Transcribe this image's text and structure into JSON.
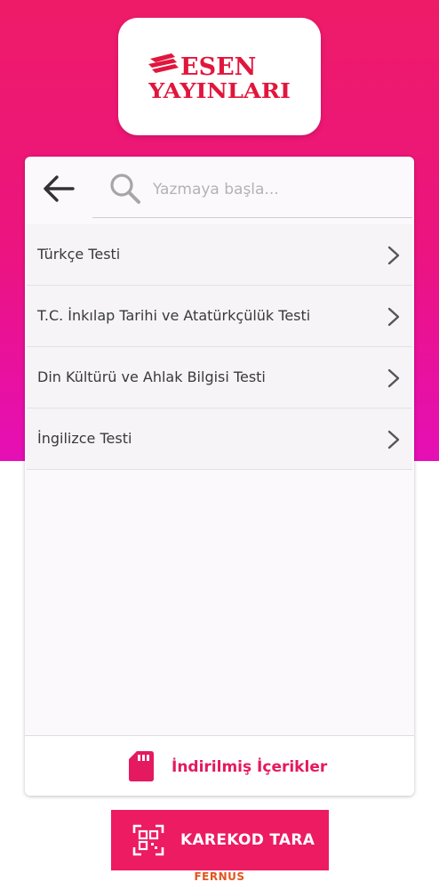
{
  "logo": {
    "line1": "ESEN",
    "line2": "YAYINLARI",
    "color": "#e1163c"
  },
  "search": {
    "placeholder": "Yazmaya başla..."
  },
  "tests": [
    {
      "label": "Türkçe Testi"
    },
    {
      "label": "T.C. İnkılap Tarihi ve Atatürkçülük Testi"
    },
    {
      "label": "Din Kültürü ve Ahlak Bilgisi Testi"
    },
    {
      "label": "İngilizce Testi"
    }
  ],
  "footer": {
    "label": "İndirilmiş İçerikler",
    "icon": "sd-card-icon"
  },
  "qr_button": {
    "label": "KAREKOD TARA",
    "icon": "qr-scan-icon"
  },
  "brand": "FERNUS",
  "colors": {
    "accent": "#ec1b62",
    "gradient_top": "#ee1b68",
    "gradient_bottom": "#e50fb6"
  }
}
